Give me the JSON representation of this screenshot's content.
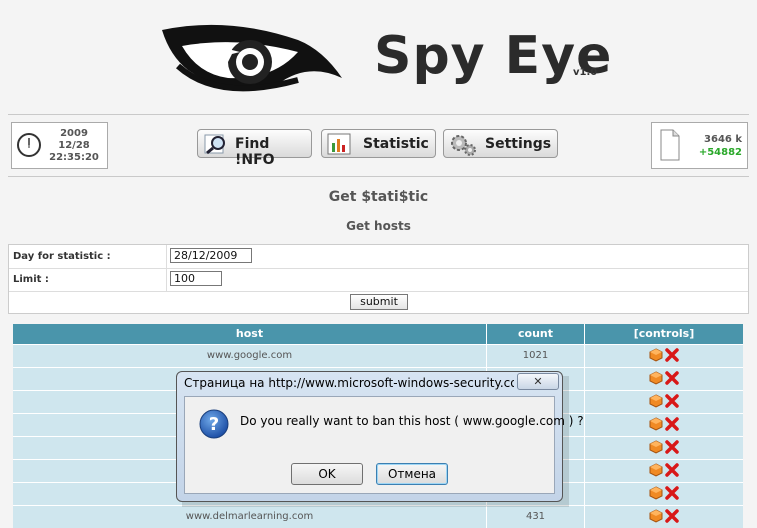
{
  "header": {
    "title": "Spy Eye",
    "version": "v1.0"
  },
  "clock": {
    "year": "2009",
    "date": "12/28",
    "time": "22:35:20"
  },
  "nav": {
    "find_info": "Find !NFO",
    "statistic": "Statistic",
    "settings": "Settings"
  },
  "file_stats": {
    "size": "3646 k",
    "delta": "+54882"
  },
  "page": {
    "title": "Get $tati$tic",
    "subtitle": "Get hosts"
  },
  "form": {
    "day_label": "Day for statistic :",
    "day_value": "28/12/2009",
    "limit_label": "Limit :",
    "limit_value": "100",
    "submit_label": "submit"
  },
  "table": {
    "headers": [
      "host",
      "count",
      "[controls]"
    ],
    "rows": [
      {
        "host": "www.google.com",
        "count": "1021"
      },
      {
        "host": "",
        "count": ""
      },
      {
        "host": "",
        "count": ""
      },
      {
        "host": "",
        "count": ""
      },
      {
        "host": "",
        "count": ""
      },
      {
        "host": "",
        "count": ""
      },
      {
        "host": "",
        "count": ""
      },
      {
        "host": "www.delmarlearning.com",
        "count": "431"
      }
    ]
  },
  "dialog": {
    "title": "Страница на http://www.microsoft-windows-security.com co...",
    "close_glyph": "✕",
    "message": "Do you really want to ban this host ( www.google.com ) ?",
    "ok_label": "OK",
    "cancel_label": "Отмена"
  },
  "colors": {
    "table_header": "#4a95ab",
    "table_row": "#cfe6ee",
    "delta_green": "#2aa82a"
  }
}
